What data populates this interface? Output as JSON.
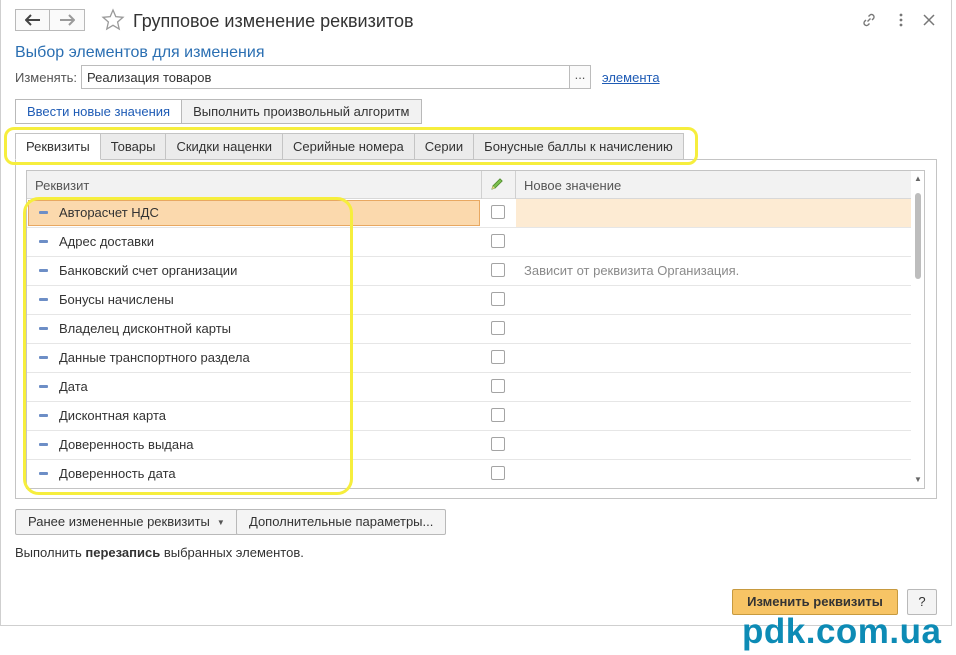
{
  "window": {
    "title": "Групповое изменение реквизитов",
    "subtitle": "Выбор элементов для изменения"
  },
  "change_row": {
    "label": "Изменять:",
    "value": "Реализация товаров",
    "ellipsis": "...",
    "link": "элемента"
  },
  "mode_buttons": [
    "Ввести новые значения",
    "Выполнить произвольный алгоритм"
  ],
  "tabs": [
    "Реквизиты",
    "Товары",
    "Скидки наценки",
    "Серийные номера",
    "Серии",
    "Бонусные баллы к начислению"
  ],
  "grid": {
    "col_requisite": "Реквизит",
    "col_new_value": "Новое значение",
    "rows": [
      {
        "label": "Авторасчет НДС",
        "note": ""
      },
      {
        "label": "Адрес доставки",
        "note": ""
      },
      {
        "label": "Банковский счет организации",
        "note": "Зависит от реквизита Организация."
      },
      {
        "label": "Бонусы начислены",
        "note": ""
      },
      {
        "label": "Владелец дисконтной карты",
        "note": ""
      },
      {
        "label": "Данные транспортного раздела",
        "note": ""
      },
      {
        "label": "Дата",
        "note": ""
      },
      {
        "label": "Дисконтная карта",
        "note": ""
      },
      {
        "label": "Доверенность выдана",
        "note": ""
      },
      {
        "label": "Доверенность дата",
        "note": ""
      }
    ]
  },
  "footer": {
    "prev_changed": "Ранее измененные реквизиты",
    "extra_params": "Дополнительные параметры...",
    "message_prefix": "Выполнить ",
    "message_bold": "перезапись",
    "message_suffix": " выбранных элементов.",
    "apply": "Изменить реквизиты",
    "help": "?"
  },
  "watermark": "pdk.com.ua",
  "colors": {
    "accent_link": "#1e5bb5",
    "subtitle": "#2b6fb2",
    "primary_button": "#f7c465",
    "highlight": "#f6ee3d",
    "watermark": "#0d8bb5"
  }
}
